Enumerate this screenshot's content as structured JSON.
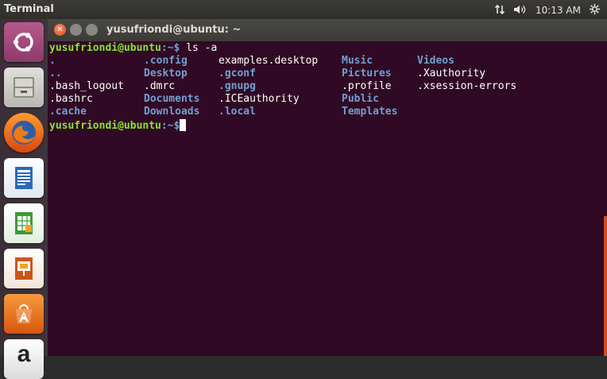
{
  "panel": {
    "app_title": "Terminal",
    "time": "10:13 AM",
    "icons": [
      "network-icon",
      "volume-icon",
      "settings-gear-icon"
    ]
  },
  "launcher": {
    "items": [
      {
        "name": "ubuntu-dash",
        "icon": "ubuntu-logo-icon"
      },
      {
        "name": "files",
        "icon": "file-cabinet-icon"
      },
      {
        "name": "firefox",
        "icon": "firefox-icon"
      },
      {
        "name": "libreoffice-writer",
        "icon": "writer-icon"
      },
      {
        "name": "libreoffice-calc",
        "icon": "calc-icon"
      },
      {
        "name": "libreoffice-impress",
        "icon": "impress-icon"
      },
      {
        "name": "ubuntu-software",
        "icon": "software-center-icon"
      },
      {
        "name": "amazon",
        "icon": "amazon-icon",
        "glyph": "a"
      }
    ]
  },
  "window": {
    "title": "yusufriondi@ubuntu: ~"
  },
  "terminal": {
    "prompt_user": "yusufriondi@ubuntu",
    "prompt_path": ":~$",
    "command": " ls -a",
    "listing": [
      [
        {
          "t": ".",
          "dir": true
        },
        {
          "t": ".config",
          "dir": true
        },
        {
          "t": "examples.desktop",
          "dir": false
        },
        {
          "t": "Music",
          "dir": true
        },
        {
          "t": "Videos",
          "dir": true
        }
      ],
      [
        {
          "t": "..",
          "dir": true
        },
        {
          "t": "Desktop",
          "dir": true
        },
        {
          "t": ".gconf",
          "dir": true
        },
        {
          "t": "Pictures",
          "dir": true
        },
        {
          "t": ".Xauthority",
          "dir": false
        }
      ],
      [
        {
          "t": ".bash_logout",
          "dir": false
        },
        {
          "t": ".dmrc",
          "dir": false
        },
        {
          "t": ".gnupg",
          "dir": true
        },
        {
          "t": ".profile",
          "dir": false
        },
        {
          "t": ".xsession-errors",
          "dir": false
        }
      ],
      [
        {
          "t": ".bashrc",
          "dir": false
        },
        {
          "t": "Documents",
          "dir": true
        },
        {
          "t": ".ICEauthority",
          "dir": false
        },
        {
          "t": "Public",
          "dir": true
        },
        {
          "t": "",
          "dir": false
        }
      ],
      [
        {
          "t": ".cache",
          "dir": true
        },
        {
          "t": "Downloads",
          "dir": true
        },
        {
          "t": ".local",
          "dir": true
        },
        {
          "t": "Templates",
          "dir": true
        },
        {
          "t": "",
          "dir": false
        }
      ]
    ]
  }
}
